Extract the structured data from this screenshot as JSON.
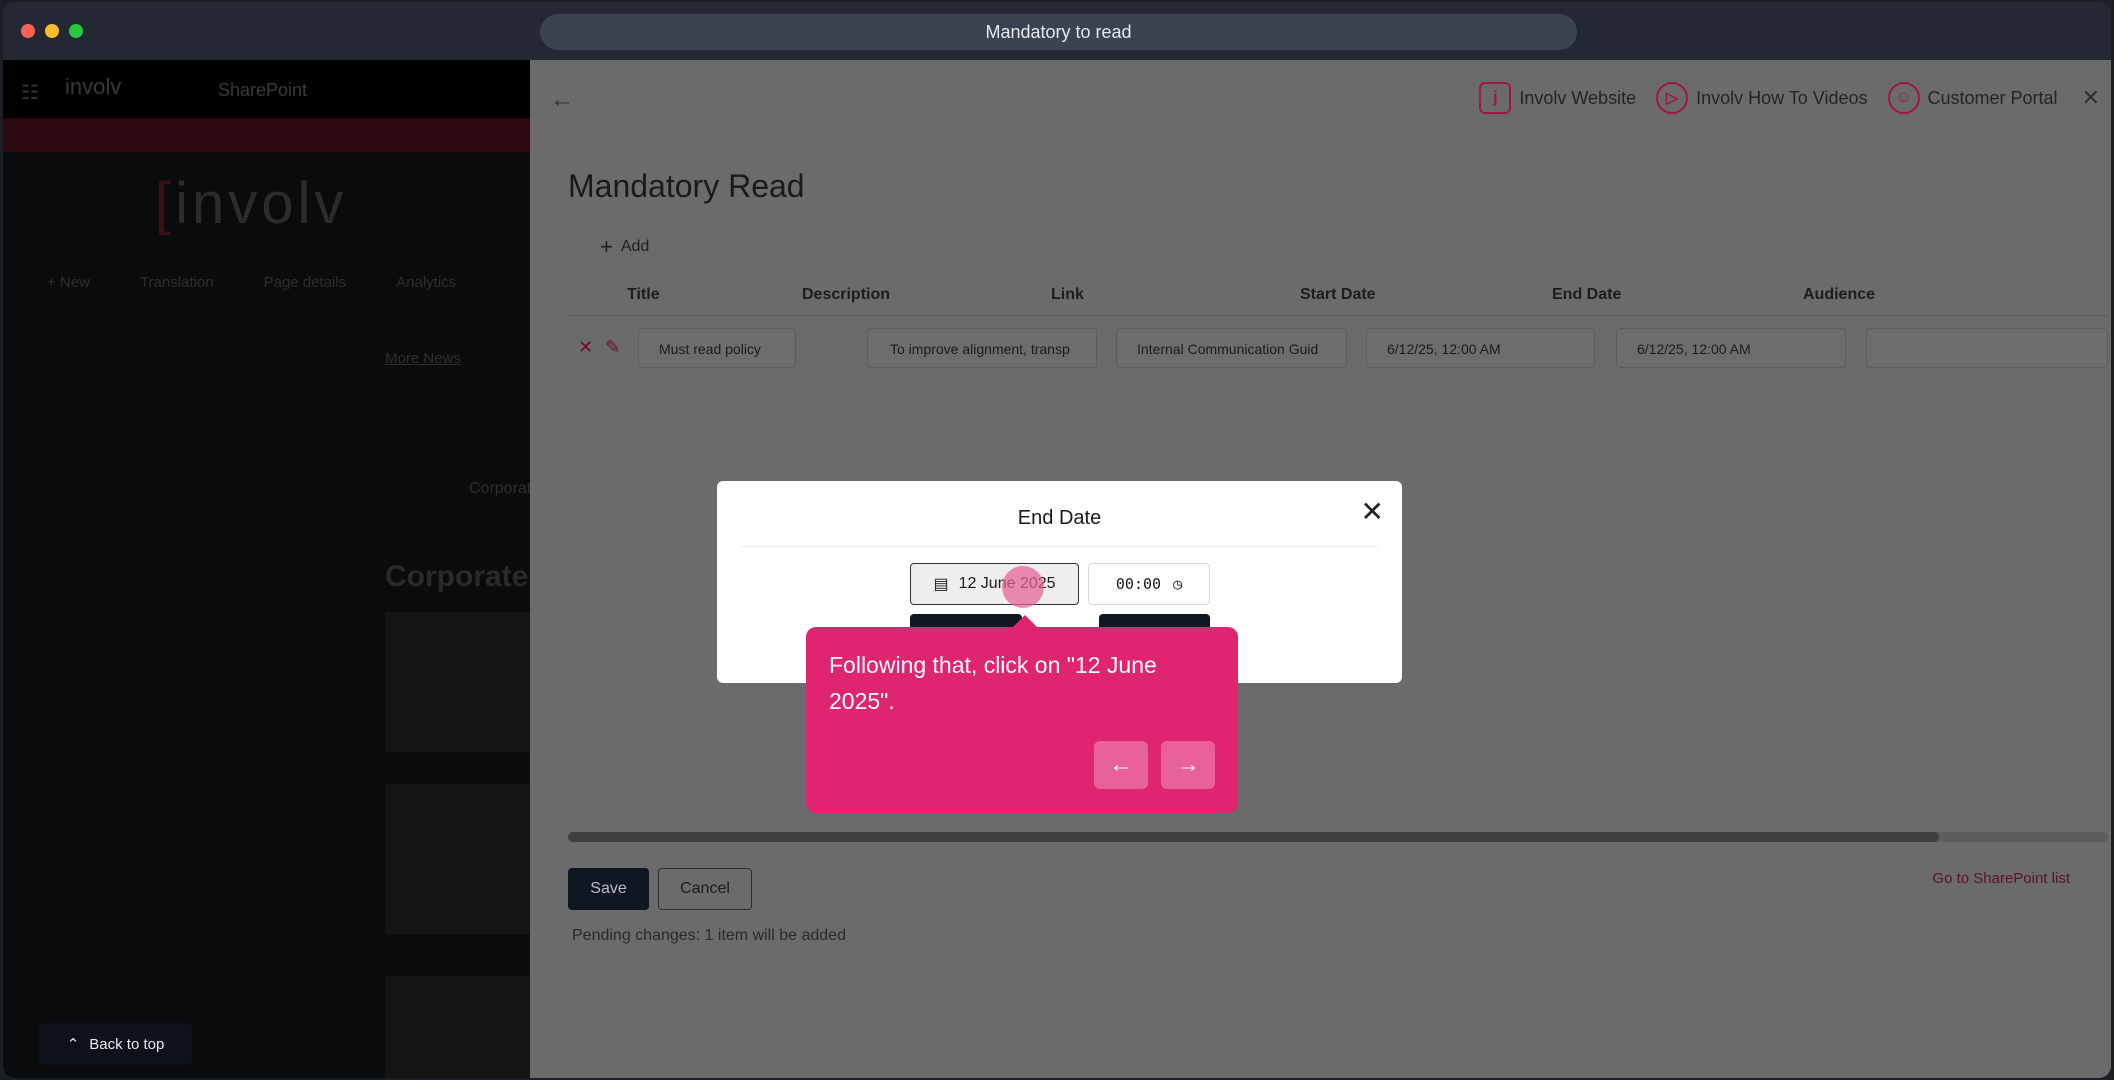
{
  "window": {
    "title": "Mandatory to read"
  },
  "background": {
    "brand_small": "involv",
    "sharepoint_label": "SharePoint",
    "logo_text": "involv",
    "command_bar": [
      "+ New",
      "Translation",
      "Page details",
      "Analytics"
    ],
    "more_news": "More News",
    "corporate_small": "Corporat",
    "corporate_heading": "Corporate",
    "back_to_top": "Back to top"
  },
  "panel": {
    "nav": {
      "website": "Involv Website",
      "videos": "Involv How To Videos",
      "portal": "Customer Portal"
    },
    "title": "Mandatory Read",
    "add_label": "Add",
    "columns": [
      "Title",
      "Description",
      "Link",
      "Start Date",
      "End Date",
      "Audience"
    ],
    "row": {
      "title": "Must read policy",
      "description": "To improve alignment, transp",
      "link": "Internal Communication Guid",
      "start_date": "6/12/25, 12:00 AM",
      "end_date": "6/12/25, 12:00 AM",
      "audience": ""
    },
    "scroll_fraction": 0.89,
    "save_label": "Save",
    "cancel_label": "Cancel",
    "sharepoint_link": "Go to SharePoint list",
    "pending_text": "Pending changes: 1 item will be added"
  },
  "modal": {
    "title": "End Date",
    "date_value": "12 June 2025",
    "time_value": "00:00"
  },
  "tooltip": {
    "text": "Following that, click on \"12 June 2025\"."
  },
  "colors": {
    "accent": "#df2470",
    "brand": "#a01840",
    "dark_button": "#101622"
  }
}
